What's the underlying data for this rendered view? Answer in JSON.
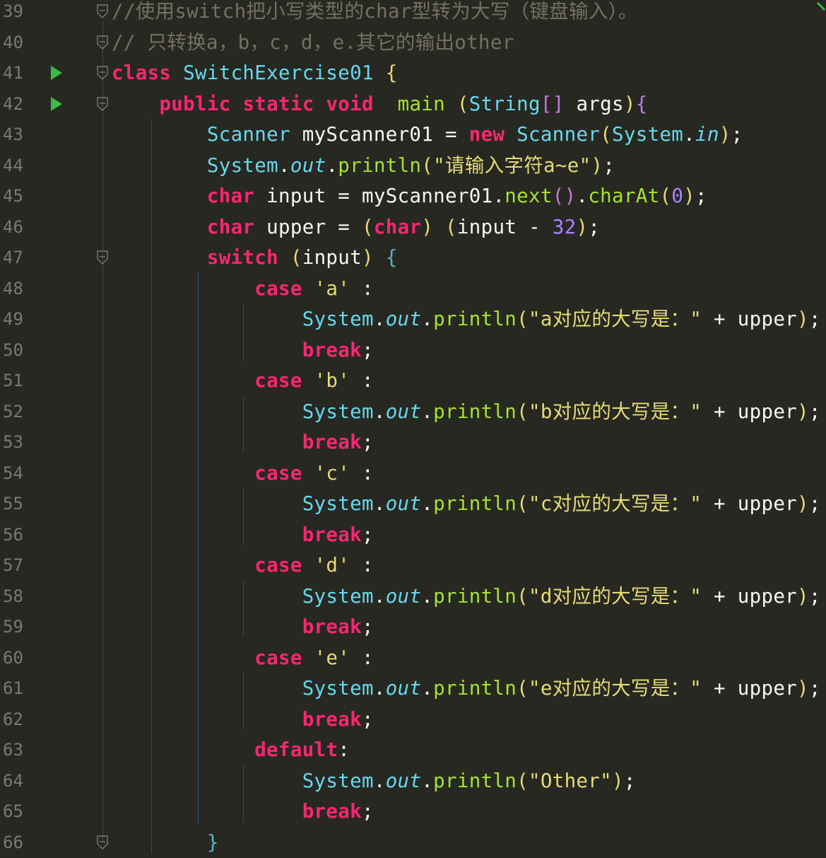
{
  "editor": {
    "language": "java",
    "theme_colors": {
      "background": "#272822",
      "keyword": "#f92672",
      "type": "#66d9ef",
      "function": "#a6e22e",
      "string": "#e6db74",
      "comment": "#75715e",
      "number": "#ae81ff",
      "run_icon": "#3cba4a"
    },
    "lines": [
      {
        "number": "39",
        "tokens": [
          {
            "t": "//使用switch把小写类型的char型转为大写（键盘输入）。",
            "c": "cm"
          }
        ]
      },
      {
        "number": "40",
        "tokens": [
          {
            "t": "// 只转换a，b，c，d，e.其它的输出other",
            "c": "cm"
          }
        ]
      },
      {
        "number": "41",
        "tokens": [
          {
            "t": "class ",
            "c": "kw"
          },
          {
            "t": "SwitchExercise01 ",
            "c": "ty"
          },
          {
            "t": "{",
            "c": "p1"
          }
        ]
      },
      {
        "number": "42",
        "tokens": [
          {
            "t": "    "
          },
          {
            "t": "public ",
            "c": "kw"
          },
          {
            "t": "static ",
            "c": "kw"
          },
          {
            "t": "void ",
            "c": "kw"
          },
          {
            "t": " main ",
            "c": "fn"
          },
          {
            "t": "(",
            "c": "p1"
          },
          {
            "t": "String",
            "c": "ty"
          },
          {
            "t": "[] ",
            "c": "p2"
          },
          {
            "t": "args",
            "c": "tx"
          },
          {
            "t": ")",
            "c": "p1"
          },
          {
            "t": "{",
            "c": "p2"
          }
        ]
      },
      {
        "number": "43",
        "tokens": [
          {
            "t": "        "
          },
          {
            "t": "Scanner ",
            "c": "ty"
          },
          {
            "t": "myScanner01 ",
            "c": "tx"
          },
          {
            "t": "= ",
            "c": "tx"
          },
          {
            "t": "new ",
            "c": "kw"
          },
          {
            "t": "Scanner",
            "c": "ty"
          },
          {
            "t": "(",
            "c": "p1"
          },
          {
            "t": "System",
            "c": "ty"
          },
          {
            "t": ".",
            "c": "tx"
          },
          {
            "t": "in",
            "c": "it"
          },
          {
            "t": ")",
            "c": "p1"
          },
          {
            "t": ";",
            "c": "tx"
          }
        ]
      },
      {
        "number": "44",
        "tokens": [
          {
            "t": "        "
          },
          {
            "t": "System",
            "c": "ty"
          },
          {
            "t": ".",
            "c": "tx"
          },
          {
            "t": "out",
            "c": "it"
          },
          {
            "t": ".",
            "c": "tx"
          },
          {
            "t": "println",
            "c": "fn"
          },
          {
            "t": "(",
            "c": "p1"
          },
          {
            "t": "\"请输入字符a~e\"",
            "c": "st"
          },
          {
            "t": ")",
            "c": "p1"
          },
          {
            "t": ";",
            "c": "tx"
          }
        ]
      },
      {
        "number": "45",
        "tokens": [
          {
            "t": "        "
          },
          {
            "t": "char ",
            "c": "kw"
          },
          {
            "t": "input ",
            "c": "tx"
          },
          {
            "t": "= ",
            "c": "tx"
          },
          {
            "t": "myScanner01",
            "c": "tx"
          },
          {
            "t": ".",
            "c": "tx"
          },
          {
            "t": "next",
            "c": "fn"
          },
          {
            "t": "()",
            "c": "p2"
          },
          {
            "t": ".",
            "c": "tx"
          },
          {
            "t": "charAt",
            "c": "fn"
          },
          {
            "t": "(",
            "c": "p1"
          },
          {
            "t": "0",
            "c": "nu"
          },
          {
            "t": ")",
            "c": "p1"
          },
          {
            "t": ";",
            "c": "tx"
          }
        ]
      },
      {
        "number": "46",
        "tokens": [
          {
            "t": "        "
          },
          {
            "t": "char ",
            "c": "kw"
          },
          {
            "t": "upper ",
            "c": "tx"
          },
          {
            "t": "= ",
            "c": "tx"
          },
          {
            "t": "(",
            "c": "p1"
          },
          {
            "t": "char",
            "c": "kw"
          },
          {
            "t": ") ",
            "c": "p1"
          },
          {
            "t": "(",
            "c": "p1"
          },
          {
            "t": "input ",
            "c": "tx"
          },
          {
            "t": "- ",
            "c": "tx"
          },
          {
            "t": "32",
            "c": "nu"
          },
          {
            "t": ")",
            "c": "p1"
          },
          {
            "t": ";",
            "c": "tx"
          }
        ]
      },
      {
        "number": "47",
        "tokens": [
          {
            "t": "        "
          },
          {
            "t": "switch ",
            "c": "kw"
          },
          {
            "t": "(",
            "c": "p1"
          },
          {
            "t": "input",
            "c": "tx"
          },
          {
            "t": ") ",
            "c": "p1"
          },
          {
            "t": "{",
            "c": "p3"
          }
        ]
      },
      {
        "number": "48",
        "tokens": [
          {
            "t": "            "
          },
          {
            "t": "case ",
            "c": "kw"
          },
          {
            "t": "'a' ",
            "c": "st"
          },
          {
            "t": ":",
            "c": "tx"
          }
        ]
      },
      {
        "number": "49",
        "tokens": [
          {
            "t": "                "
          },
          {
            "t": "System",
            "c": "ty"
          },
          {
            "t": ".",
            "c": "tx"
          },
          {
            "t": "out",
            "c": "it"
          },
          {
            "t": ".",
            "c": "tx"
          },
          {
            "t": "println",
            "c": "fn"
          },
          {
            "t": "(",
            "c": "p1"
          },
          {
            "t": "\"a对应的大写是：\" ",
            "c": "st"
          },
          {
            "t": "+ ",
            "c": "tx"
          },
          {
            "t": "upper",
            "c": "tx"
          },
          {
            "t": ")",
            "c": "p1"
          },
          {
            "t": ";",
            "c": "tx"
          }
        ]
      },
      {
        "number": "50",
        "tokens": [
          {
            "t": "                "
          },
          {
            "t": "break",
            "c": "kw"
          },
          {
            "t": ";",
            "c": "tx"
          }
        ]
      },
      {
        "number": "51",
        "tokens": [
          {
            "t": "            "
          },
          {
            "t": "case ",
            "c": "kw"
          },
          {
            "t": "'b' ",
            "c": "st"
          },
          {
            "t": ":",
            "c": "tx"
          }
        ]
      },
      {
        "number": "52",
        "tokens": [
          {
            "t": "                "
          },
          {
            "t": "System",
            "c": "ty"
          },
          {
            "t": ".",
            "c": "tx"
          },
          {
            "t": "out",
            "c": "it"
          },
          {
            "t": ".",
            "c": "tx"
          },
          {
            "t": "println",
            "c": "fn"
          },
          {
            "t": "(",
            "c": "p1"
          },
          {
            "t": "\"b对应的大写是：\" ",
            "c": "st"
          },
          {
            "t": "+ ",
            "c": "tx"
          },
          {
            "t": "upper",
            "c": "tx"
          },
          {
            "t": ")",
            "c": "p1"
          },
          {
            "t": ";",
            "c": "tx"
          }
        ]
      },
      {
        "number": "53",
        "tokens": [
          {
            "t": "                "
          },
          {
            "t": "break",
            "c": "kw"
          },
          {
            "t": ";",
            "c": "tx"
          }
        ]
      },
      {
        "number": "54",
        "tokens": [
          {
            "t": "            "
          },
          {
            "t": "case ",
            "c": "kw"
          },
          {
            "t": "'c' ",
            "c": "st"
          },
          {
            "t": ":",
            "c": "tx"
          }
        ]
      },
      {
        "number": "55",
        "tokens": [
          {
            "t": "                "
          },
          {
            "t": "System",
            "c": "ty"
          },
          {
            "t": ".",
            "c": "tx"
          },
          {
            "t": "out",
            "c": "it"
          },
          {
            "t": ".",
            "c": "tx"
          },
          {
            "t": "println",
            "c": "fn"
          },
          {
            "t": "(",
            "c": "p1"
          },
          {
            "t": "\"c对应的大写是：\" ",
            "c": "st"
          },
          {
            "t": "+ ",
            "c": "tx"
          },
          {
            "t": "upper",
            "c": "tx"
          },
          {
            "t": ")",
            "c": "p1"
          },
          {
            "t": ";",
            "c": "tx"
          }
        ]
      },
      {
        "number": "56",
        "tokens": [
          {
            "t": "                "
          },
          {
            "t": "break",
            "c": "kw"
          },
          {
            "t": ";",
            "c": "tx"
          }
        ]
      },
      {
        "number": "57",
        "tokens": [
          {
            "t": "            "
          },
          {
            "t": "case ",
            "c": "kw"
          },
          {
            "t": "'d' ",
            "c": "st"
          },
          {
            "t": ":",
            "c": "tx"
          }
        ]
      },
      {
        "number": "58",
        "tokens": [
          {
            "t": "                "
          },
          {
            "t": "System",
            "c": "ty"
          },
          {
            "t": ".",
            "c": "tx"
          },
          {
            "t": "out",
            "c": "it"
          },
          {
            "t": ".",
            "c": "tx"
          },
          {
            "t": "println",
            "c": "fn"
          },
          {
            "t": "(",
            "c": "p1"
          },
          {
            "t": "\"d对应的大写是：\" ",
            "c": "st"
          },
          {
            "t": "+ ",
            "c": "tx"
          },
          {
            "t": "upper",
            "c": "tx"
          },
          {
            "t": ")",
            "c": "p1"
          },
          {
            "t": ";",
            "c": "tx"
          }
        ]
      },
      {
        "number": "59",
        "tokens": [
          {
            "t": "                "
          },
          {
            "t": "break",
            "c": "kw"
          },
          {
            "t": ";",
            "c": "tx"
          }
        ]
      },
      {
        "number": "60",
        "tokens": [
          {
            "t": "            "
          },
          {
            "t": "case ",
            "c": "kw"
          },
          {
            "t": "'e' ",
            "c": "st"
          },
          {
            "t": ":",
            "c": "tx"
          }
        ]
      },
      {
        "number": "61",
        "tokens": [
          {
            "t": "                "
          },
          {
            "t": "System",
            "c": "ty"
          },
          {
            "t": ".",
            "c": "tx"
          },
          {
            "t": "out",
            "c": "it"
          },
          {
            "t": ".",
            "c": "tx"
          },
          {
            "t": "println",
            "c": "fn"
          },
          {
            "t": "(",
            "c": "p1"
          },
          {
            "t": "\"e对应的大写是：\" ",
            "c": "st"
          },
          {
            "t": "+ ",
            "c": "tx"
          },
          {
            "t": "upper",
            "c": "tx"
          },
          {
            "t": ")",
            "c": "p1"
          },
          {
            "t": ";",
            "c": "tx"
          }
        ]
      },
      {
        "number": "62",
        "tokens": [
          {
            "t": "                "
          },
          {
            "t": "break",
            "c": "kw"
          },
          {
            "t": ";",
            "c": "tx"
          }
        ]
      },
      {
        "number": "63",
        "tokens": [
          {
            "t": "            "
          },
          {
            "t": "default",
            "c": "kw"
          },
          {
            "t": ":",
            "c": "tx"
          }
        ]
      },
      {
        "number": "64",
        "tokens": [
          {
            "t": "                "
          },
          {
            "t": "System",
            "c": "ty"
          },
          {
            "t": ".",
            "c": "tx"
          },
          {
            "t": "out",
            "c": "it"
          },
          {
            "t": ".",
            "c": "tx"
          },
          {
            "t": "println",
            "c": "fn"
          },
          {
            "t": "(",
            "c": "p1"
          },
          {
            "t": "\"Other\"",
            "c": "st"
          },
          {
            "t": ")",
            "c": "p1"
          },
          {
            "t": ";",
            "c": "tx"
          }
        ]
      },
      {
        "number": "65",
        "tokens": [
          {
            "t": "                "
          },
          {
            "t": "break",
            "c": "kw"
          },
          {
            "t": ";",
            "c": "tx"
          }
        ]
      },
      {
        "number": "66",
        "tokens": [
          {
            "t": "        "
          },
          {
            "t": "}",
            "c": "p3"
          }
        ]
      }
    ],
    "run_markers": [
      "41",
      "42"
    ],
    "fold_markers": [
      "39",
      "40",
      "41",
      "42",
      "47",
      "66"
    ]
  }
}
